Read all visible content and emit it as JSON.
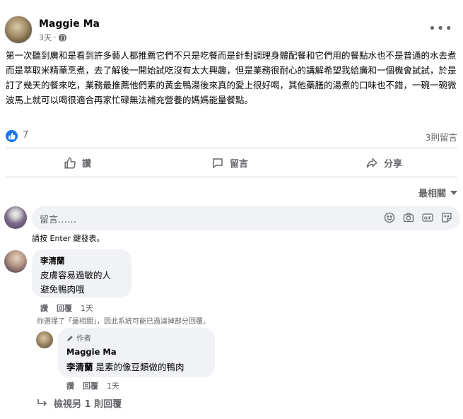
{
  "post": {
    "author": "Maggie Ma",
    "time": "3天",
    "more": "•••",
    "text": "第一次聽到廣和是看到許多藝人都推薦它們不只是吃餐而是針對調理身體配餐和它們用的餐點水也不是普通的水去煮而是萃取米精華烹煮，去了解後一開始試吃沒有太大興趣，但是業務很耐心的講解希望我給廣和一個機會試試，於是訂了幾天的餐來吃，業務最推薦他們素的黃金鴨湯後來真的愛上很好喝，其他藥膳的湯煮的口味也不錯，一碗一碗微波馬上就可以喝很適合再家忙碌無法補充營養的媽媽能量餐點。",
    "like_count": "7",
    "comment_count": "3則留言"
  },
  "actions": {
    "like": "讚",
    "comment": "留言",
    "share": "分享"
  },
  "sort_label": "最相關",
  "comment_input": {
    "placeholder": "留言……",
    "hint": "請按 Enter 鍵發表。"
  },
  "comments": [
    {
      "name": "李清蘭",
      "line1": "皮膚容易過敏的人",
      "line2": "避免鴨肉哦",
      "like": "讚",
      "reply": "回覆",
      "time": "1天"
    }
  ],
  "filter_note": "你選擇了「最相關」，因此系統可能已過濾掉部分回覆。",
  "reply": {
    "badge": "作者",
    "name": "Maggie Ma",
    "mention": "李清蘭",
    "text": " 是素的像豆類做的鴨肉",
    "like": "讚",
    "reply": "回覆",
    "time": "1天"
  },
  "view_more": "檢視另 1 則回覆",
  "colors": {
    "accent": "#1877f2",
    "muted": "#65676b",
    "bubble": "#f0f2f5"
  }
}
